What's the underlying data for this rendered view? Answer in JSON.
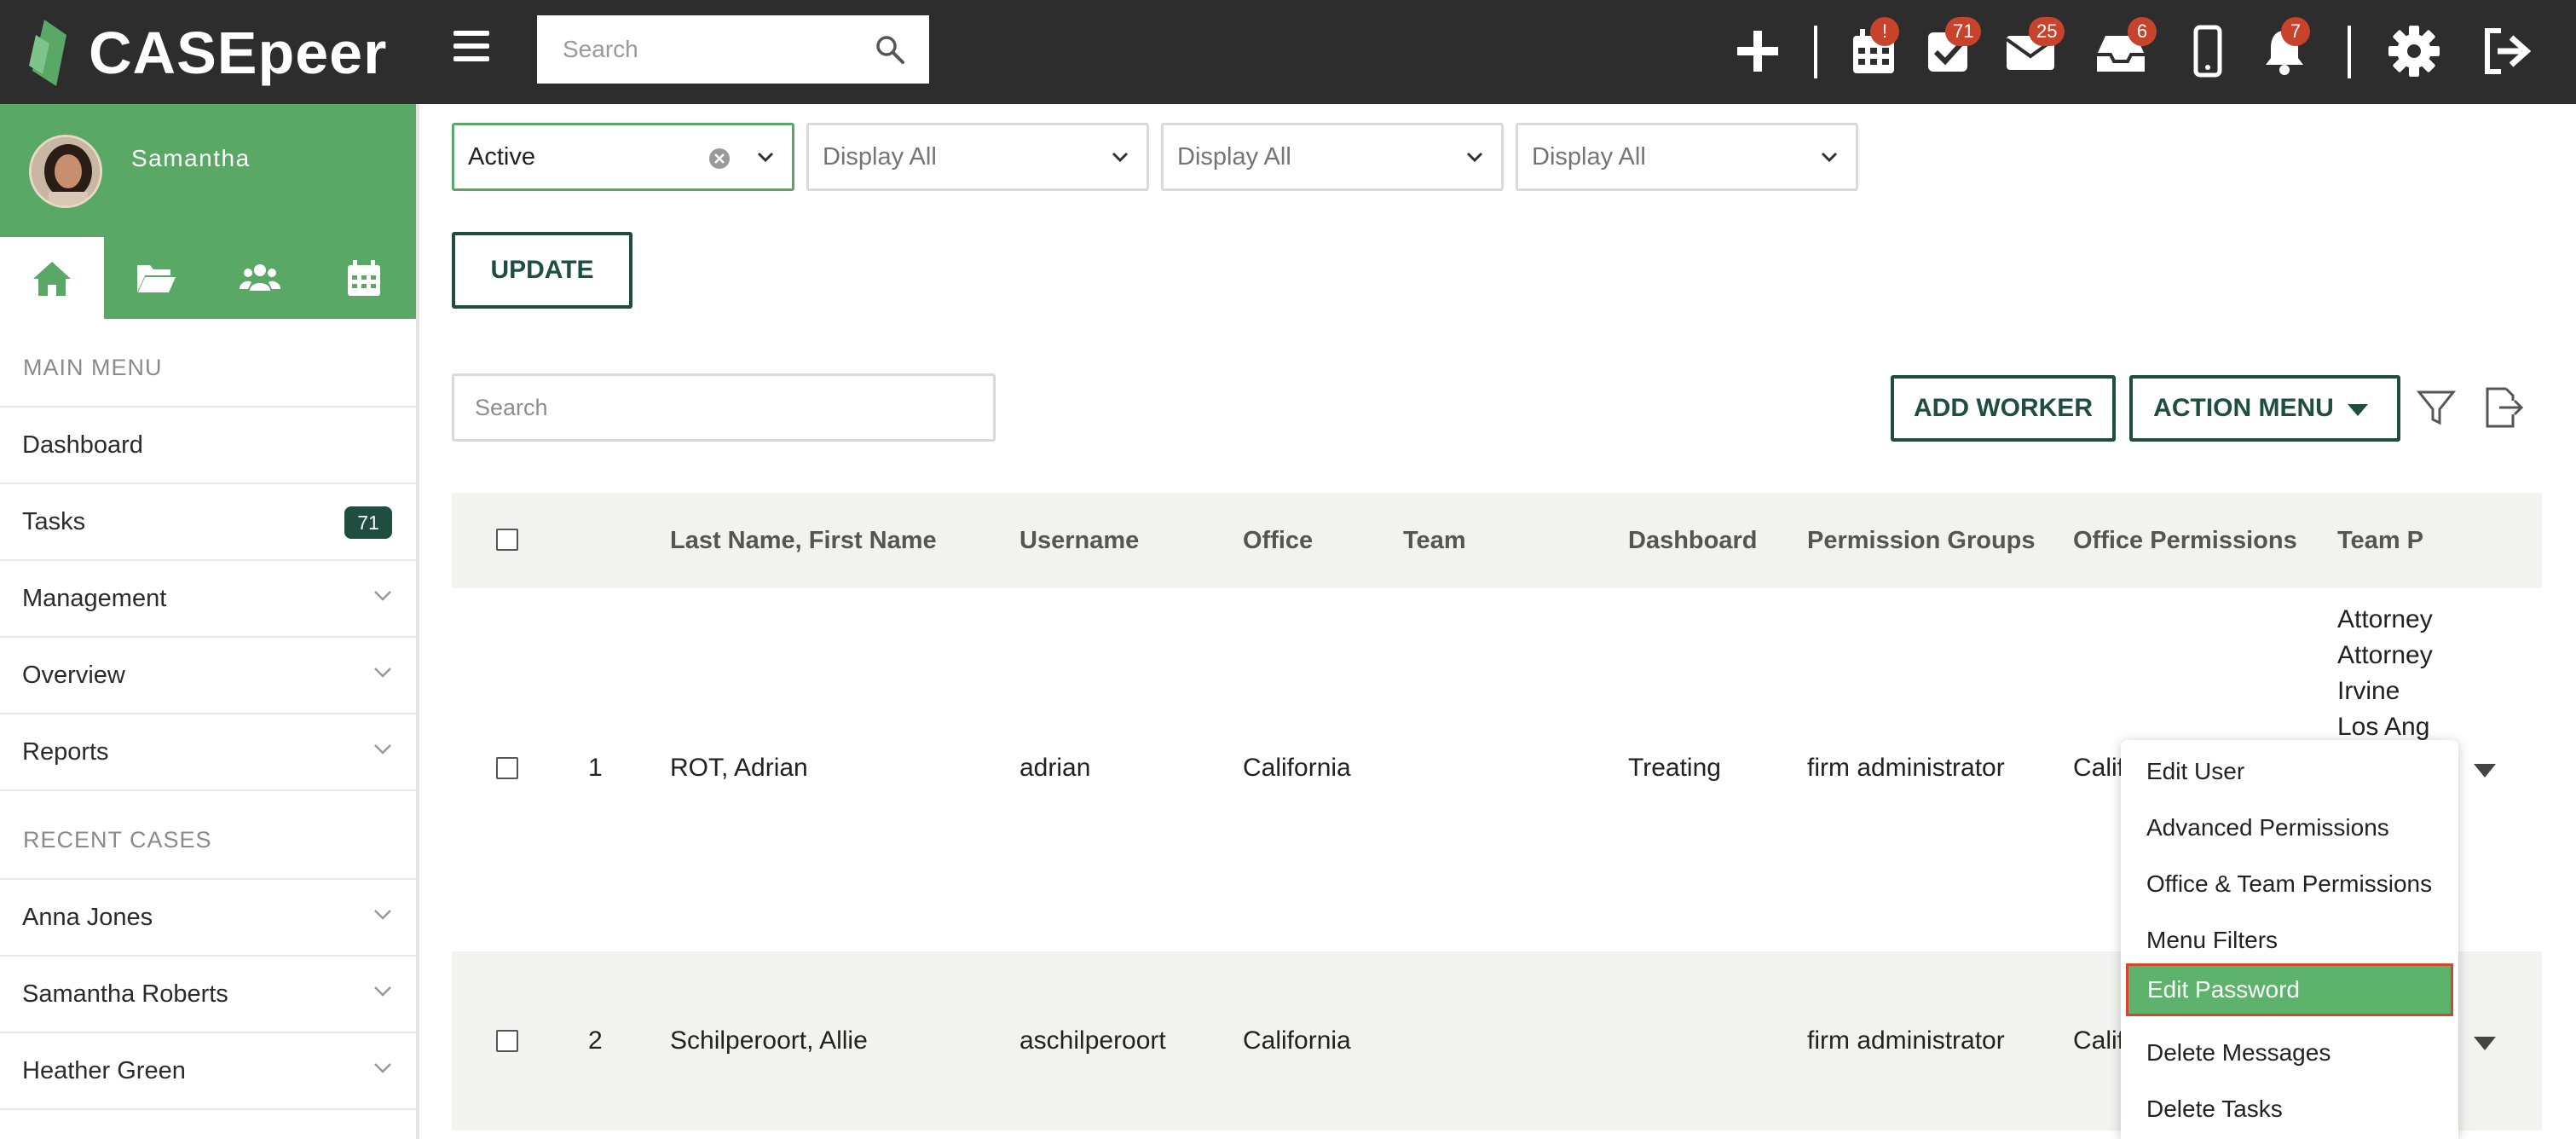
{
  "app": {
    "logo_text": "CASEpeer"
  },
  "topbar": {
    "search_placeholder": "Search",
    "icons": [
      {
        "name": "plus-icon"
      },
      {
        "name": "calendar-icon",
        "badge": "!"
      },
      {
        "name": "tasks-check-icon",
        "badge": "71"
      },
      {
        "name": "mail-icon",
        "badge": "25"
      },
      {
        "name": "inbox-tray-icon",
        "badge": "6"
      },
      {
        "name": "mobile-phone-icon"
      },
      {
        "name": "bell-icon",
        "badge": "7"
      },
      {
        "name": "gear-icon"
      },
      {
        "name": "logout-icon"
      }
    ]
  },
  "sidebar": {
    "user_name": "Samantha",
    "main_menu_label": "MAIN MENU",
    "main_menu": [
      {
        "label": "Dashboard"
      },
      {
        "label": "Tasks",
        "badge": "71"
      },
      {
        "label": "Management"
      },
      {
        "label": "Overview"
      },
      {
        "label": "Reports"
      }
    ],
    "recent_label": "RECENT CASES",
    "recent_cases": [
      {
        "label": "Anna Jones"
      },
      {
        "label": "Samantha Roberts"
      },
      {
        "label": "Heather Green"
      }
    ]
  },
  "filters": [
    {
      "value": "Active"
    },
    {
      "value": "Display All"
    },
    {
      "value": "Display All"
    },
    {
      "value": "Display All"
    }
  ],
  "buttons": {
    "update": "UPDATE",
    "add_worker": "ADD WORKER",
    "action_menu": "ACTION MENU"
  },
  "table_search_placeholder": "Search",
  "table": {
    "headers": [
      "Last Name, First Name",
      "Username",
      "Office",
      "Team",
      "Dashboard",
      "Permission Groups",
      "Office Permissions",
      "Team Pe"
    ],
    "rows": [
      {
        "num": "1",
        "name": "ROT, Adrian",
        "username": "adrian",
        "office": "California",
        "team": "",
        "dashboard": "Treating",
        "permission_groups": "firm administrator",
        "office_permissions": "Calif",
        "team_permissions": [
          "Attorney",
          "Attorney",
          "Irvine",
          "Los Ang"
        ]
      },
      {
        "num": "2",
        "name": "Schilperoort, Allie",
        "username": "aschilperoort",
        "office": "California",
        "team": "",
        "dashboard": "",
        "permission_groups": "firm administrator",
        "office_permissions": "Calif",
        "team_permissions": []
      }
    ]
  },
  "row_menu": {
    "items": [
      {
        "label": "Edit User"
      },
      {
        "label": "Advanced Permissions"
      },
      {
        "label": "Office & Team Permissions"
      },
      {
        "label": "Menu Filters"
      },
      {
        "label": "Edit Password",
        "highlighted": true
      },
      {
        "label": "Delete Messages"
      },
      {
        "label": "Delete Tasks"
      }
    ]
  },
  "colors": {
    "topbar": "#2d2d2d",
    "brand_green": "#5aa866",
    "dark_green": "#1f4d3f",
    "badge_red": "#c8432c",
    "highlight_outline": "#d3472e"
  }
}
